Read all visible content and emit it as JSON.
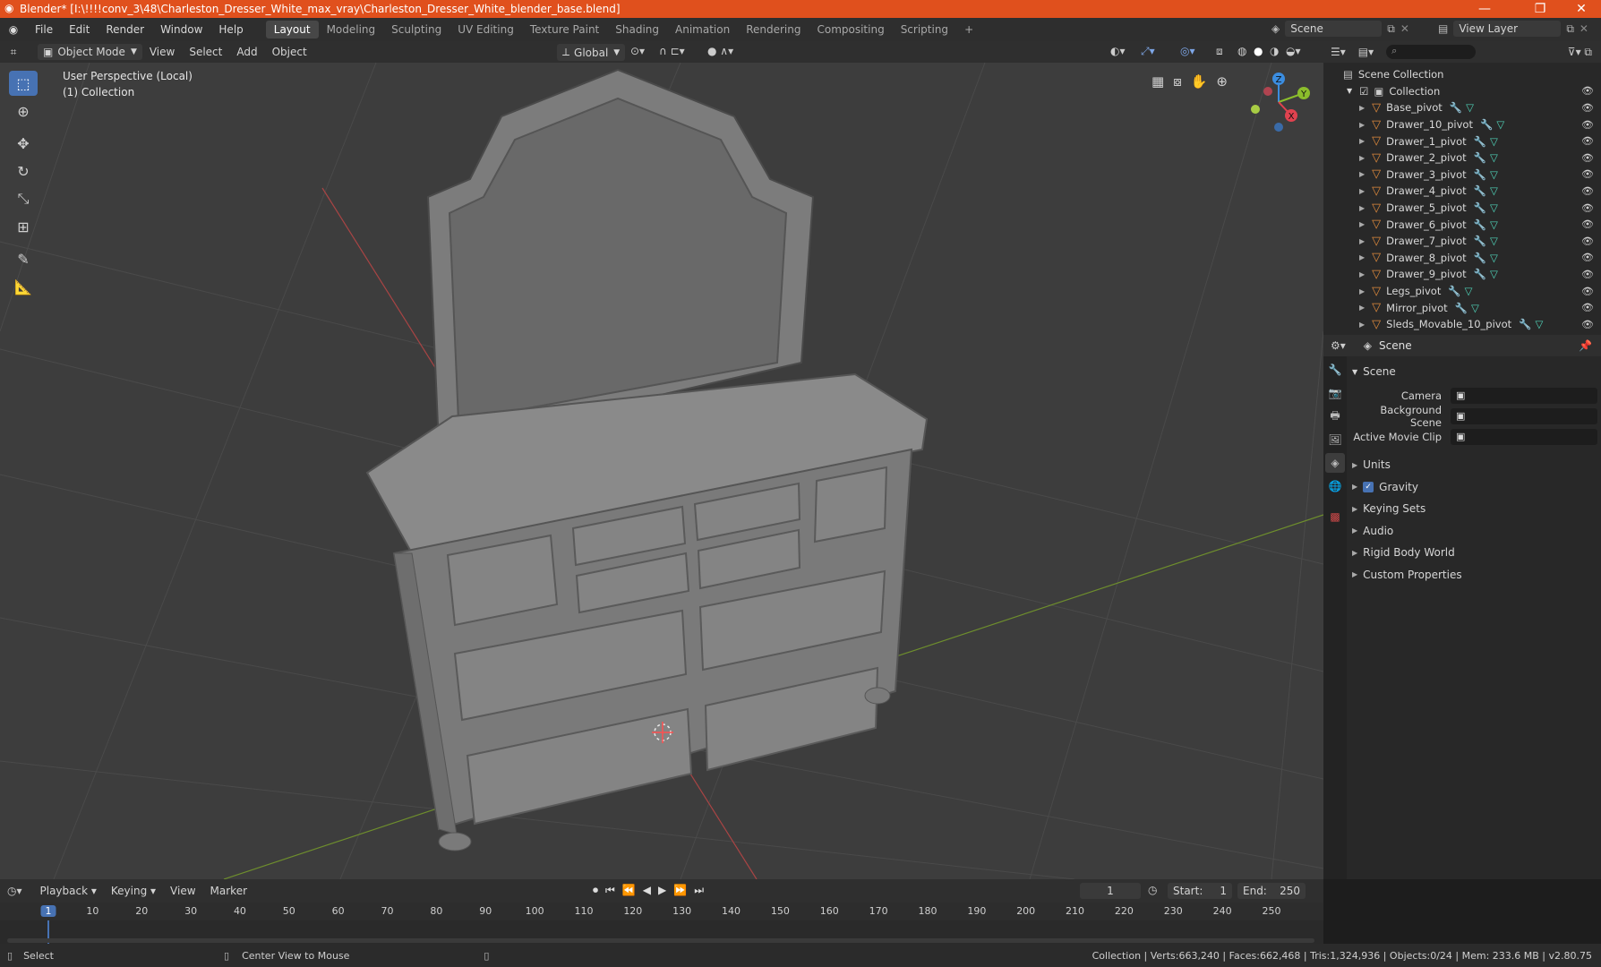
{
  "app": {
    "title": "Blender* [I:\\!!!!conv_3\\48\\Charleston_Dresser_White_max_vray\\Charleston_Dresser_White_blender_base.blend]",
    "window_controls": [
      "—",
      "❐",
      "✕"
    ]
  },
  "menu": [
    "File",
    "Edit",
    "Render",
    "Window",
    "Help"
  ],
  "workspaces": [
    "Layout",
    "Modeling",
    "Sculpting",
    "UV Editing",
    "Texture Paint",
    "Shading",
    "Animation",
    "Rendering",
    "Compositing",
    "Scripting"
  ],
  "workspace_active": "Layout",
  "workspace_add": "+",
  "scene_field": "Scene",
  "view_layer_field": "View Layer",
  "viewport_header": {
    "mode": "Object Mode",
    "menus": [
      "View",
      "Select",
      "Add",
      "Object"
    ],
    "transform": "Global"
  },
  "viewport": {
    "perspective_label": "User Perspective (Local)",
    "collection_label": "(1) Collection",
    "gizmo": {
      "z": "Z",
      "y": "Y",
      "x": "X"
    }
  },
  "outliner": {
    "root": "Scene Collection",
    "collection": "Collection",
    "items": [
      "Base_pivot",
      "Drawer_10_pivot",
      "Drawer_1_pivot",
      "Drawer_2_pivot",
      "Drawer_3_pivot",
      "Drawer_4_pivot",
      "Drawer_5_pivot",
      "Drawer_6_pivot",
      "Drawer_7_pivot",
      "Drawer_8_pivot",
      "Drawer_9_pivot",
      "Legs_pivot",
      "Mirror_pivot",
      "Sleds_Movable_10_pivot"
    ]
  },
  "properties": {
    "context": "Scene",
    "panel_title": "Scene",
    "fields": [
      {
        "label": "Camera"
      },
      {
        "label": "Background Scene"
      },
      {
        "label": "Active Movie Clip"
      }
    ],
    "sections": [
      "Units",
      "Gravity",
      "Keying Sets",
      "Audio",
      "Rigid Body World",
      "Custom Properties"
    ]
  },
  "timeline": {
    "menus": [
      "Playback",
      "Keying",
      "View",
      "Marker"
    ],
    "current_frame": "1",
    "start_label": "Start:",
    "start": "1",
    "end_label": "End:",
    "end": "250",
    "ruler_labels": [
      "1",
      "10",
      "20",
      "30",
      "40",
      "50",
      "60",
      "70",
      "80",
      "90",
      "100",
      "110",
      "120",
      "130",
      "140",
      "150",
      "160",
      "170",
      "180",
      "190",
      "200",
      "210",
      "220",
      "230",
      "240",
      "250"
    ]
  },
  "statusbar": {
    "left_action": "Select",
    "mid_action": "Center View to Mouse",
    "stats": "Collection | Verts:663,240 | Faces:662,468 | Tris:1,324,936 | Objects:0/24 | Mem: 233.6 MB | v2.80.75"
  },
  "colors": {
    "title_bar": "#e0501d",
    "active_tool": "#4772b3",
    "x_axis": "#e0424f",
    "y_axis": "#8bbd2c",
    "z_axis": "#3b8de0"
  }
}
